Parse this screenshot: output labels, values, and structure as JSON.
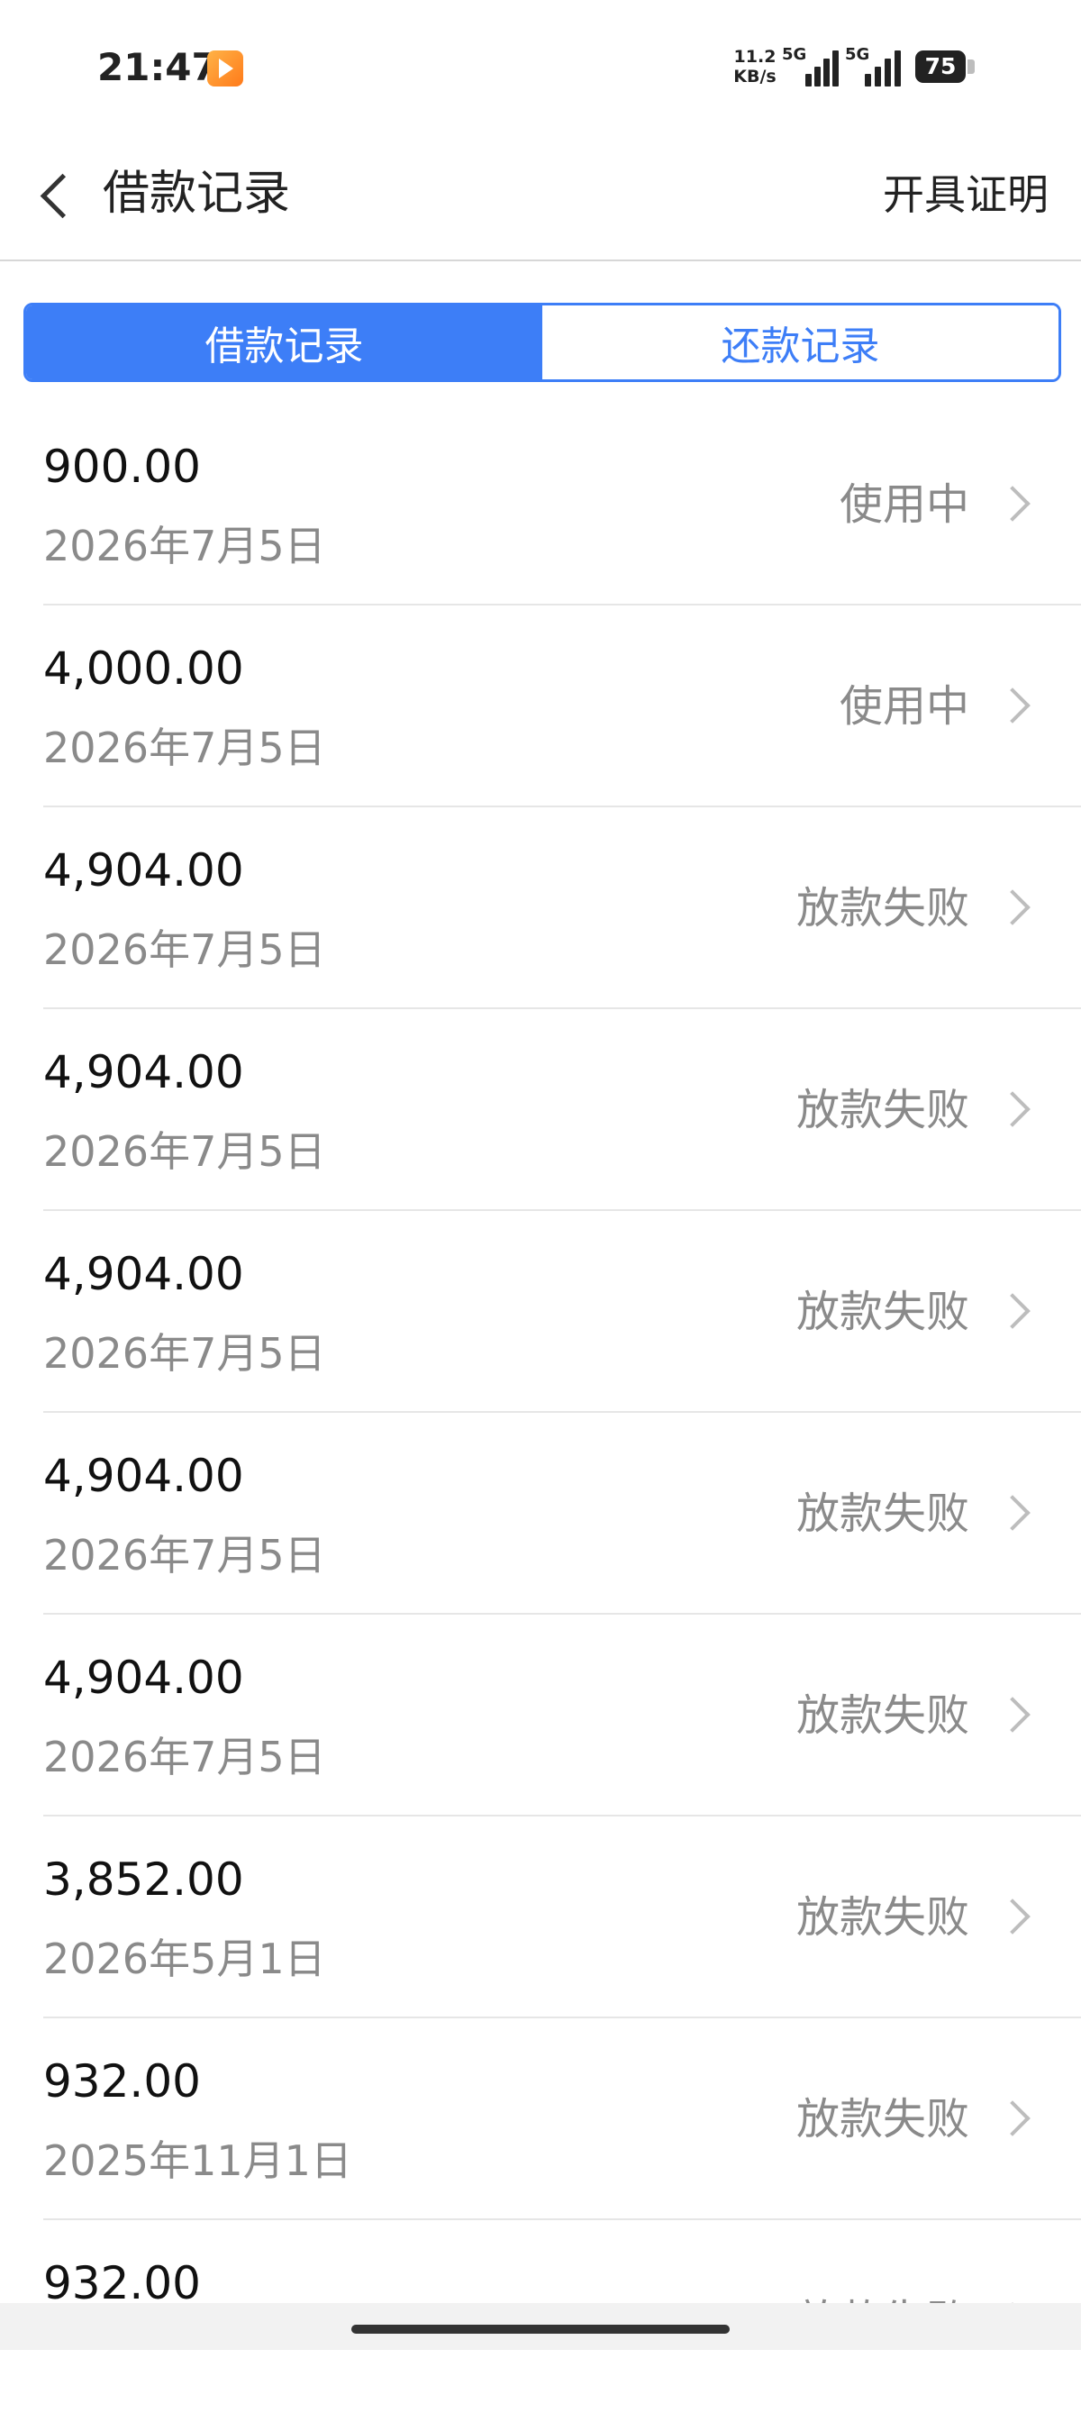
{
  "status_bar": {
    "time": "21:47",
    "net_speed_value": "11.2",
    "net_speed_unit": "KB/s",
    "signal_1_label": "5G",
    "signal_2_label": "5G",
    "battery": "75"
  },
  "header": {
    "title": "借款记录",
    "action": "开具证明"
  },
  "tabs": [
    {
      "label": "借款记录",
      "active": true
    },
    {
      "label": "还款记录",
      "active": false
    }
  ],
  "records": [
    {
      "amount": "900.00",
      "date": "2026年7月5日",
      "status": "使用中"
    },
    {
      "amount": "4,000.00",
      "date": "2026年7月5日",
      "status": "使用中"
    },
    {
      "amount": "4,904.00",
      "date": "2026年7月5日",
      "status": "放款失败"
    },
    {
      "amount": "4,904.00",
      "date": "2026年7月5日",
      "status": "放款失败"
    },
    {
      "amount": "4,904.00",
      "date": "2026年7月5日",
      "status": "放款失败"
    },
    {
      "amount": "4,904.00",
      "date": "2026年7月5日",
      "status": "放款失败"
    },
    {
      "amount": "4,904.00",
      "date": "2026年7月5日",
      "status": "放款失败"
    },
    {
      "amount": "3,852.00",
      "date": "2026年5月1日",
      "status": "放款失败"
    },
    {
      "amount": "932.00",
      "date": "2025年11月1日",
      "status": "放款失败"
    },
    {
      "amount": "932.00",
      "date": "",
      "status": "放款失败"
    }
  ],
  "colors": {
    "accent": "#3d7ef7",
    "secondary_text": "#8a8a8a"
  }
}
